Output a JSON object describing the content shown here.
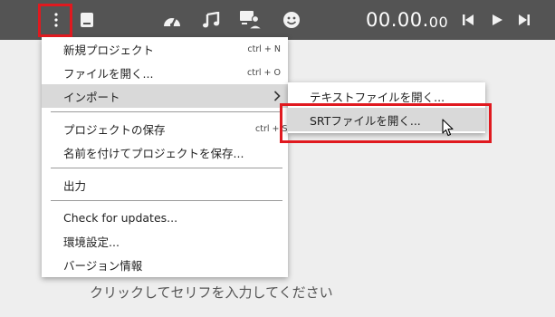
{
  "toolbar": {
    "icons": [
      "more-vertical-icon",
      "file-icon",
      "speedometer-icon",
      "music-icon",
      "screen-user-icon",
      "smiley-icon",
      "skip-back-icon",
      "play-icon",
      "skip-forward-icon"
    ],
    "time_main": "00.00.",
    "time_ms": "00"
  },
  "menu": {
    "new_project": {
      "label": "新規プロジェクト",
      "shortcut": "ctrl + N"
    },
    "open_file": {
      "label": "ファイルを開く...",
      "shortcut": "ctrl + O"
    },
    "import": {
      "label": "インポート"
    },
    "save_project": {
      "label": "プロジェクトの保存",
      "shortcut": "ctrl + S"
    },
    "save_as": {
      "label": "名前を付けてプロジェクトを保存..."
    },
    "output": {
      "label": "出力"
    },
    "check_updates": {
      "label": "Check for updates..."
    },
    "settings": {
      "label": "環境設定..."
    },
    "version": {
      "label": "バージョン情報"
    }
  },
  "submenu": {
    "open_text": "テキストファイルを開く...",
    "open_srt": "SRTファイルを開く..."
  },
  "main": {
    "placeholder": "クリックしてセリフを入力してください"
  },
  "colors": {
    "toolbar_bg": "#545454",
    "highlight_red": "#e0191f",
    "hover_gray": "#d9d9d9"
  }
}
